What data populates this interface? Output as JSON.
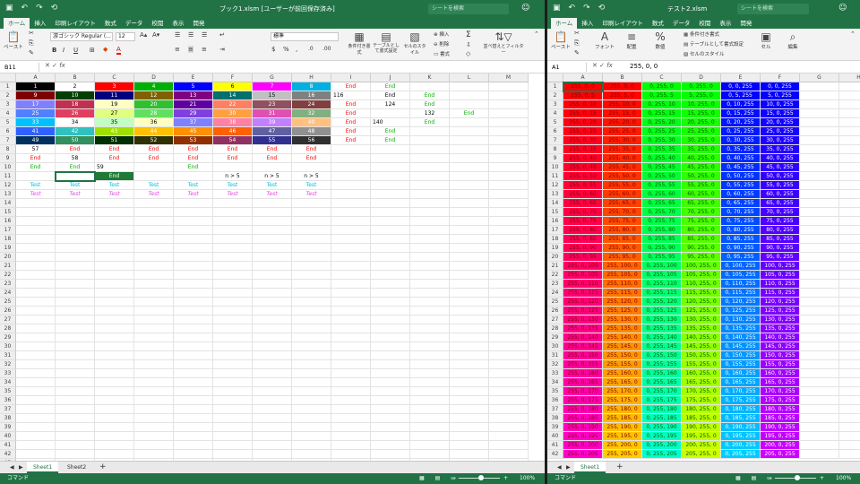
{
  "left": {
    "title": "ブック1.xlsm [ユーザーが前回保存済み]",
    "search_placeholder": "シートを検索",
    "tabs": [
      "ホーム",
      "挿入",
      "印刷レイアウト",
      "数式",
      "データ",
      "校閲",
      "表示",
      "開発"
    ],
    "ribbon": {
      "paste": "ペースト",
      "font_name": "游ゴシック Regular (...",
      "font_size": "12",
      "number_format": "標準",
      "cond_format": "条件付き書式",
      "table_format": "テーブルとして書式設定",
      "cell_style": "セルのスタイル",
      "insert": "挿入",
      "delete": "削除",
      "format": "書式",
      "sort_filter": "並べ替えとフィルター"
    },
    "name_box": "B11",
    "formula": "",
    "columns": [
      "A",
      "B",
      "C",
      "D",
      "E",
      "F",
      "G",
      "H",
      "I",
      "J",
      "K",
      "L",
      "M"
    ],
    "rows": [
      [
        {
          "v": "1",
          "bg": "#000000",
          "c": "#ffffff"
        },
        {
          "v": "2",
          "bg": "#ffffff",
          "c": "#000000"
        },
        {
          "v": "3",
          "bg": "#ff0000",
          "c": "#ffffff"
        },
        {
          "v": "4",
          "bg": "#00b000",
          "c": "#ffffff"
        },
        {
          "v": "5",
          "bg": "#0000ff",
          "c": "#ffffff"
        },
        {
          "v": "6",
          "bg": "#ffff00",
          "c": "#000000"
        },
        {
          "v": "7",
          "bg": "#ff00ff",
          "c": "#ffffff"
        },
        {
          "v": "8",
          "bg": "#00b0e0",
          "c": "#ffffff"
        },
        {
          "v": "End",
          "c": "#ff0000"
        },
        {
          "v": "End",
          "c": "#00b000"
        },
        {
          "v": ""
        },
        {
          "v": ""
        },
        {
          "v": ""
        }
      ],
      [
        {
          "v": "9",
          "bg": "#800000",
          "c": "#ffffff"
        },
        {
          "v": "10",
          "bg": "#004000",
          "c": "#ffffff"
        },
        {
          "v": "11",
          "bg": "#000080",
          "c": "#ffffff"
        },
        {
          "v": "12",
          "bg": "#806000",
          "c": "#ffffff"
        },
        {
          "v": "13",
          "bg": "#800080",
          "c": "#ffffff"
        },
        {
          "v": "14",
          "bg": "#007070",
          "c": "#ffffff"
        },
        {
          "v": "15",
          "bg": "#c0c0c0",
          "c": "#000000"
        },
        {
          "v": "16",
          "bg": "#808080",
          "c": "#ffffff"
        },
        {
          "v": "116",
          "c": "#000000",
          "t": "lft"
        },
        {
          "v": "End",
          "c": "#000000"
        },
        {
          "v": "End",
          "c": "#00b000"
        },
        {
          "v": ""
        },
        {
          "v": ""
        }
      ],
      [
        {
          "v": "17",
          "bg": "#8080ff",
          "c": "#ffffff"
        },
        {
          "v": "18",
          "bg": "#c03050",
          "c": "#ffffff"
        },
        {
          "v": "19",
          "bg": "#ffffc0",
          "c": "#000000"
        },
        {
          "v": "20",
          "bg": "#30c030",
          "c": "#ffffff"
        },
        {
          "v": "21",
          "bg": "#6000a0",
          "c": "#ffffff"
        },
        {
          "v": "22",
          "bg": "#ff8060",
          "c": "#ffffff"
        },
        {
          "v": "23",
          "bg": "#905060",
          "c": "#ffffff"
        },
        {
          "v": "24",
          "bg": "#804040",
          "c": "#ffffff"
        },
        {
          "v": "End",
          "c": "#ff0000"
        },
        {
          "v": "124",
          "c": "#000000"
        },
        {
          "v": "End",
          "c": "#00b000"
        },
        {
          "v": ""
        },
        {
          "v": ""
        }
      ],
      [
        {
          "v": "25",
          "bg": "#5080ff",
          "c": "#ffffff"
        },
        {
          "v": "26",
          "bg": "#e04060",
          "c": "#ffffff"
        },
        {
          "v": "27",
          "bg": "#e0ff80",
          "c": "#000000"
        },
        {
          "v": "28",
          "bg": "#60e060",
          "c": "#ffffff"
        },
        {
          "v": "29",
          "bg": "#8040e0",
          "c": "#ffffff"
        },
        {
          "v": "30",
          "bg": "#ffa040",
          "c": "#ffffff"
        },
        {
          "v": "31",
          "bg": "#e050b0",
          "c": "#ffffff"
        },
        {
          "v": "32",
          "bg": "#80b080",
          "c": "#ffffff"
        },
        {
          "v": "End",
          "c": "#ff0000"
        },
        {
          "v": ""
        },
        {
          "v": "132",
          "c": "#000000"
        },
        {
          "v": "End",
          "c": "#00b000"
        },
        {
          "v": ""
        }
      ],
      [
        {
          "v": "33",
          "bg": "#00c0ff",
          "c": "#ffffff"
        },
        {
          "v": "34",
          "bg": "#ffffff",
          "c": "#000000"
        },
        {
          "v": "35",
          "bg": "#c0ffc0",
          "c": "#000000"
        },
        {
          "v": "36",
          "bg": "#ffffc0",
          "c": "#000000"
        },
        {
          "v": "37",
          "bg": "#8080ff",
          "c": "#ffffff"
        },
        {
          "v": "38",
          "bg": "#ff80a0",
          "c": "#ffffff"
        },
        {
          "v": "39",
          "bg": "#c080ff",
          "c": "#ffffff"
        },
        {
          "v": "40",
          "bg": "#ffc080",
          "c": "#ffffff"
        },
        {
          "v": "End",
          "c": "#ff0000"
        },
        {
          "v": "140",
          "c": "#000000",
          "t": "lft"
        },
        {
          "v": "End",
          "c": "#00b000"
        },
        {
          "v": ""
        },
        {
          "v": ""
        }
      ],
      [
        {
          "v": "41",
          "bg": "#3060ff",
          "c": "#ffffff"
        },
        {
          "v": "42",
          "bg": "#30c0c0",
          "c": "#ffffff"
        },
        {
          "v": "43",
          "bg": "#a0e000",
          "c": "#ffffff"
        },
        {
          "v": "44",
          "bg": "#ffc000",
          "c": "#ffffff"
        },
        {
          "v": "45",
          "bg": "#ff9000",
          "c": "#ffffff"
        },
        {
          "v": "46",
          "bg": "#ff6000",
          "c": "#ffffff"
        },
        {
          "v": "47",
          "bg": "#6060a0",
          "c": "#ffffff"
        },
        {
          "v": "48",
          "bg": "#909090",
          "c": "#ffffff"
        },
        {
          "v": "End",
          "c": "#ff0000"
        },
        {
          "v": "End",
          "c": "#00b000"
        },
        {
          "v": ""
        },
        {
          "v": ""
        },
        {
          "v": ""
        }
      ],
      [
        {
          "v": "49",
          "bg": "#003060",
          "c": "#ffffff"
        },
        {
          "v": "50",
          "bg": "#309060",
          "c": "#ffffff"
        },
        {
          "v": "51",
          "bg": "#003000",
          "c": "#ffffff"
        },
        {
          "v": "52",
          "bg": "#303000",
          "c": "#ffffff"
        },
        {
          "v": "53",
          "bg": "#903000",
          "c": "#ffffff"
        },
        {
          "v": "54",
          "bg": "#903060",
          "c": "#ffffff"
        },
        {
          "v": "55",
          "bg": "#303090",
          "c": "#ffffff"
        },
        {
          "v": "56",
          "bg": "#303030",
          "c": "#ffffff"
        },
        {
          "v": "End",
          "c": "#ff0000"
        },
        {
          "v": "End",
          "c": "#00b000"
        },
        {
          "v": ""
        },
        {
          "v": ""
        },
        {
          "v": ""
        }
      ],
      [
        {
          "v": "57",
          "c": "#000000"
        },
        {
          "v": "End",
          "c": "#ff0000"
        },
        {
          "v": "End",
          "c": "#ff0000"
        },
        {
          "v": "End",
          "c": "#ff0000"
        },
        {
          "v": "End",
          "c": "#ff0000"
        },
        {
          "v": "End",
          "c": "#ff0000"
        },
        {
          "v": "End",
          "c": "#ff0000"
        },
        {
          "v": "End",
          "c": "#ff0000"
        },
        {
          "v": ""
        },
        {
          "v": ""
        },
        {
          "v": ""
        },
        {
          "v": ""
        },
        {
          "v": ""
        }
      ],
      [
        {
          "v": "End",
          "c": "#ff0000"
        },
        {
          "v": "58",
          "c": "#000000"
        },
        {
          "v": "End",
          "c": "#ff0000"
        },
        {
          "v": "End",
          "c": "#ff0000"
        },
        {
          "v": "End",
          "c": "#ff0000"
        },
        {
          "v": "End",
          "c": "#ff0000"
        },
        {
          "v": "End",
          "c": "#ff0000"
        },
        {
          "v": "End",
          "c": "#ff0000"
        },
        {
          "v": ""
        },
        {
          "v": ""
        },
        {
          "v": ""
        },
        {
          "v": ""
        },
        {
          "v": ""
        }
      ],
      [
        {
          "v": "End",
          "c": "#00b000"
        },
        {
          "v": "End",
          "c": "#00b000"
        },
        {
          "v": "59",
          "c": "#000000",
          "t": "lft"
        },
        {
          "v": ""
        },
        {
          "v": "End",
          "c": "#00b000"
        },
        {
          "v": ""
        },
        {
          "v": ""
        },
        {
          "v": ""
        },
        {
          "v": ""
        },
        {
          "v": ""
        },
        {
          "v": ""
        },
        {
          "v": ""
        },
        {
          "v": ""
        }
      ],
      [
        {
          "v": ""
        },
        {
          "v": "",
          "sel": true
        },
        {
          "v": "End",
          "bg": "#1e7a35",
          "c": "#ffffff"
        },
        {
          "v": ""
        },
        {
          "v": ""
        },
        {
          "v": "n > 5",
          "c": "#000000"
        },
        {
          "v": "n > 5",
          "c": "#000000"
        },
        {
          "v": "n > 5",
          "c": "#000000"
        },
        {
          "v": ""
        },
        {
          "v": ""
        },
        {
          "v": ""
        },
        {
          "v": ""
        },
        {
          "v": ""
        }
      ],
      [
        {
          "v": "Test",
          "c": "#00c0e0"
        },
        {
          "v": "Test",
          "c": "#00c0e0"
        },
        {
          "v": "Test",
          "c": "#00c0e0"
        },
        {
          "v": "Test",
          "c": "#00c0e0"
        },
        {
          "v": "Test",
          "c": "#00c0e0"
        },
        {
          "v": "Test",
          "c": "#00c0e0"
        },
        {
          "v": "Test",
          "c": "#00c0e0"
        },
        {
          "v": "Test",
          "c": "#00c0e0"
        },
        {
          "v": ""
        },
        {
          "v": ""
        },
        {
          "v": ""
        },
        {
          "v": ""
        },
        {
          "v": ""
        }
      ],
      [
        {
          "v": "Test",
          "c": "#e040e0",
          "i": true
        },
        {
          "v": "Test",
          "c": "#e040e0",
          "i": true
        },
        {
          "v": "Test",
          "c": "#e040e0",
          "i": true
        },
        {
          "v": "Test",
          "c": "#e040e0",
          "i": true
        },
        {
          "v": "Test",
          "c": "#e040e0",
          "i": true
        },
        {
          "v": "Test",
          "c": "#e040e0",
          "i": true
        },
        {
          "v": "Test",
          "c": "#e040e0",
          "i": true
        },
        {
          "v": "Test",
          "c": "#e040e0",
          "i": true
        },
        {
          "v": ""
        },
        {
          "v": ""
        },
        {
          "v": ""
        },
        {
          "v": ""
        },
        {
          "v": ""
        }
      ]
    ],
    "row_count": 43,
    "sheets": [
      "Sheet1",
      "Sheet2"
    ],
    "status_left": "コマンド",
    "zoom": "100%"
  },
  "right": {
    "title": "テスト2.xlsm",
    "search_placeholder": "シートを検索",
    "tabs": [
      "ホーム",
      "挿入",
      "印刷レイアウト",
      "数式",
      "データ",
      "校閲",
      "表示",
      "開発"
    ],
    "ribbon": {
      "paste": "ペースト",
      "font": "フォント",
      "align": "配置",
      "number": "数値",
      "cond_format": "条件付き書式",
      "table_format": "テーブルとして書式設定",
      "cell_style": "セルのスタイル",
      "cells": "セル",
      "edit": "編集"
    },
    "name_box": "A1",
    "formula": "255, 0, 0",
    "columns": [
      "A",
      "B",
      "C",
      "D",
      "E",
      "F",
      "G",
      "H"
    ],
    "row_count": 42,
    "sheets": [
      "Sheet1"
    ],
    "status_left": "コマンド",
    "zoom": "100%"
  }
}
